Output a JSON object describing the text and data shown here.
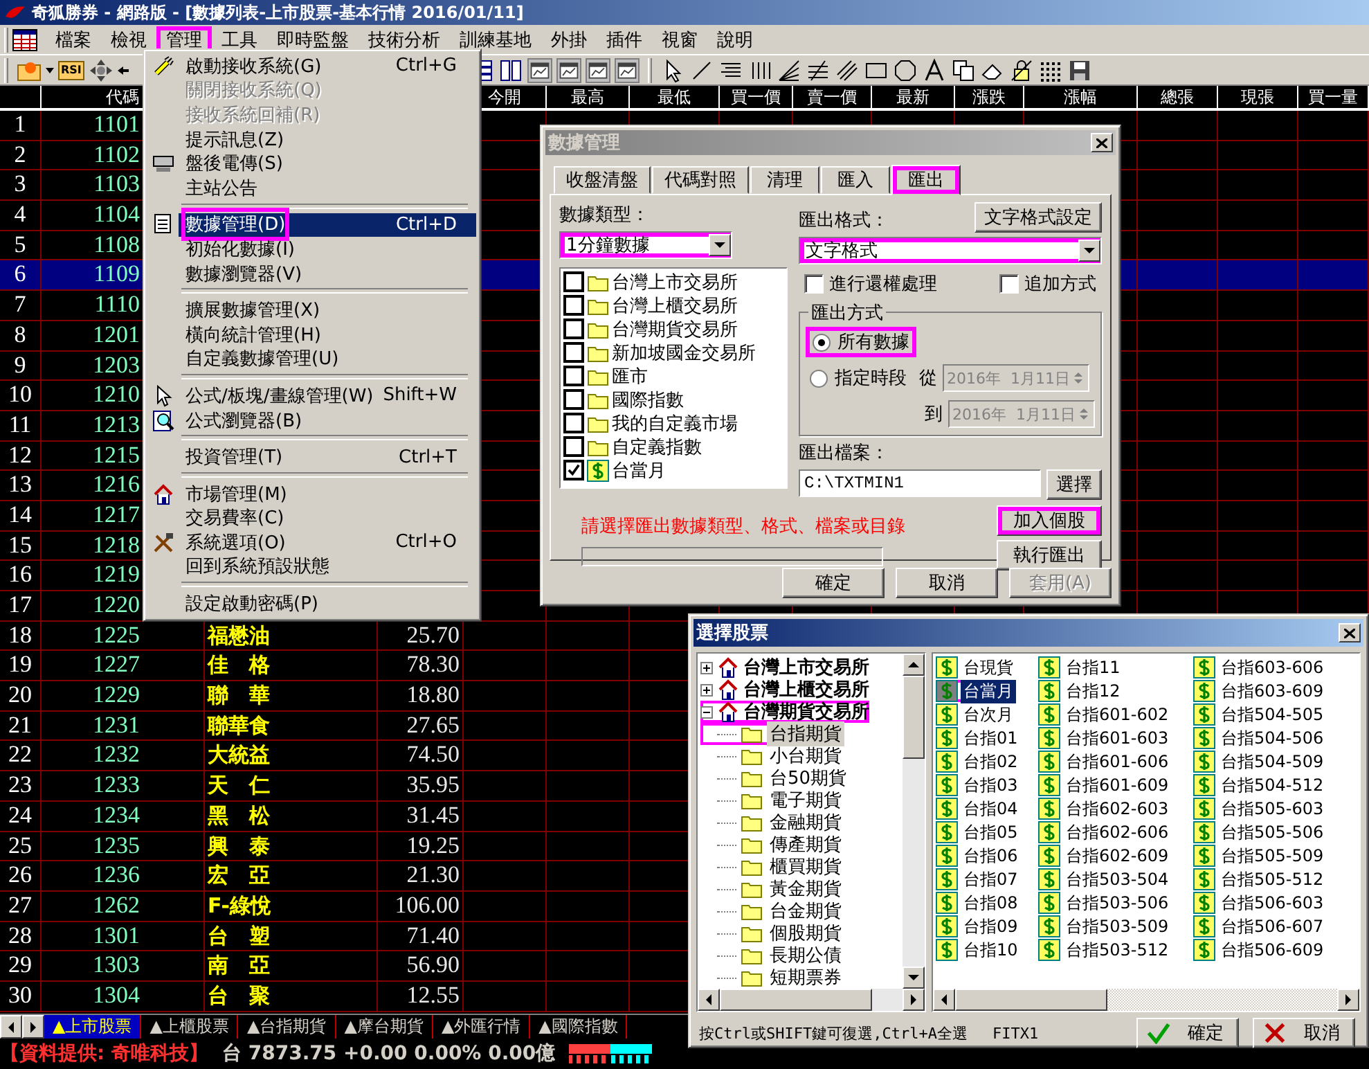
{
  "window": {
    "title": "奇狐勝券 - 網路版 - [數據列表-上市股票-基本行情 2016/01/11]"
  },
  "menu_bar": [
    {
      "label": "檔案",
      "highlighted": false
    },
    {
      "label": "檢視",
      "highlighted": false
    },
    {
      "label": "管理",
      "highlighted": true
    },
    {
      "label": "工具",
      "highlighted": false
    },
    {
      "label": "即時監盤",
      "highlighted": false
    },
    {
      "label": "技術分析",
      "highlighted": false
    },
    {
      "label": "訓練基地",
      "highlighted": false
    },
    {
      "label": "外掛",
      "highlighted": false
    },
    {
      "label": "插件",
      "highlighted": false
    },
    {
      "label": "視窗",
      "highlighted": false
    },
    {
      "label": "說明",
      "highlighted": false
    }
  ],
  "toolbar": {
    "rsi_label": "RSI"
  },
  "table": {
    "columns": [
      {},
      {
        "label": "代碼"
      },
      {},
      {},
      {
        "label": "今開"
      },
      {
        "label": "最高"
      },
      {
        "label": "最低"
      },
      {
        "label": "買一價"
      },
      {
        "label": "賣一價"
      },
      {
        "label": "最新"
      },
      {
        "label": "漲跌"
      },
      {
        "label": "漲幅"
      },
      {
        "label": "總張"
      },
      {
        "label": "現張"
      },
      {
        "label": "買一量"
      }
    ],
    "rows": [
      {
        "number": "1",
        "code": "1101",
        "selected": false
      },
      {
        "number": "2",
        "code": "1102",
        "selected": false
      },
      {
        "number": "3",
        "code": "1103",
        "selected": false
      },
      {
        "number": "4",
        "code": "1104",
        "selected": false
      },
      {
        "number": "5",
        "code": "1108",
        "selected": false
      },
      {
        "number": "6",
        "code": "1109",
        "selected": true
      },
      {
        "number": "7",
        "code": "1110",
        "selected": false
      },
      {
        "number": "8",
        "code": "1201",
        "selected": false
      },
      {
        "number": "9",
        "code": "1203",
        "selected": false
      },
      {
        "number": "10",
        "code": "1210",
        "selected": false
      },
      {
        "number": "11",
        "code": "1213",
        "selected": false
      },
      {
        "number": "12",
        "code": "1215",
        "selected": false
      },
      {
        "number": "13",
        "code": "1216",
        "selected": false
      },
      {
        "number": "14",
        "code": "1217",
        "selected": false
      },
      {
        "number": "15",
        "code": "1218",
        "selected": false
      },
      {
        "number": "16",
        "code": "1219",
        "selected": false
      },
      {
        "number": "17",
        "code": "1220",
        "selected": false
      },
      {
        "number": "18",
        "code": "1225",
        "name": "福懋油",
        "price": "25.70",
        "selected": false
      },
      {
        "number": "19",
        "code": "1227",
        "name": "佳　格",
        "price": "78.30",
        "selected": false
      },
      {
        "number": "20",
        "code": "1229",
        "name": "聯　華",
        "price": "18.80",
        "selected": false
      },
      {
        "number": "21",
        "code": "1231",
        "name": "聯華食",
        "price": "27.65",
        "selected": false
      },
      {
        "number": "22",
        "code": "1232",
        "name": "大統益",
        "price": "74.50",
        "selected": false
      },
      {
        "number": "23",
        "code": "1233",
        "name": "天　仁",
        "price": "35.95",
        "selected": false
      },
      {
        "number": "24",
        "code": "1234",
        "name": "黑　松",
        "price": "31.45",
        "selected": false
      },
      {
        "number": "25",
        "code": "1235",
        "name": "興　泰",
        "price": "19.25",
        "selected": false
      },
      {
        "number": "26",
        "code": "1236",
        "name": "宏　亞",
        "price": "21.30",
        "selected": false
      },
      {
        "number": "27",
        "code": "1262",
        "name": "F-綠悅",
        "price": "106.00",
        "selected": false
      },
      {
        "number": "28",
        "code": "1301",
        "name": "台　塑",
        "price": "71.40",
        "selected": false
      },
      {
        "number": "29",
        "code": "1303",
        "name": "南　亞",
        "price": "56.90",
        "selected": false
      },
      {
        "number": "30",
        "code": "1304",
        "name": "台　聚",
        "price": "12.55",
        "selected": false
      }
    ]
  },
  "menu": {
    "items": [
      {
        "kind": "item",
        "label": "啟動接收系統(G)",
        "shortcut": "Ctrl+G",
        "disabled": false,
        "selected": false,
        "highlighted": false
      },
      {
        "kind": "item",
        "label": "關閉接收系統(Q)",
        "disabled": true,
        "selected": false,
        "highlighted": false
      },
      {
        "kind": "item",
        "label": "接收系統回補(R)",
        "disabled": true,
        "selected": false,
        "highlighted": false
      },
      {
        "kind": "item",
        "label": "提示訊息(Z)",
        "disabled": false,
        "selected": false,
        "highlighted": false
      },
      {
        "kind": "item",
        "label": "盤後電傳(S)",
        "disabled": false,
        "selected": false,
        "highlighted": false
      },
      {
        "kind": "item",
        "label": "主站公告",
        "disabled": false,
        "selected": false,
        "highlighted": false
      },
      {
        "kind": "separator"
      },
      {
        "kind": "item",
        "label": "數據管理(D)",
        "shortcut": "Ctrl+D",
        "disabled": false,
        "selected": true,
        "highlighted": true
      },
      {
        "kind": "item",
        "label": "初始化數據(I)",
        "disabled": false,
        "selected": false,
        "highlighted": false
      },
      {
        "kind": "item",
        "label": "數據瀏覽器(V)",
        "disabled": false,
        "selected": false,
        "highlighted": false
      },
      {
        "kind": "separator"
      },
      {
        "kind": "item",
        "label": "擴展數據管理(X)",
        "disabled": false,
        "selected": false,
        "highlighted": false
      },
      {
        "kind": "item",
        "label": "橫向統計管理(H)",
        "disabled": false,
        "selected": false,
        "highlighted": false
      },
      {
        "kind": "item",
        "label": "自定義數據管理(U)",
        "disabled": false,
        "selected": false,
        "highlighted": false
      },
      {
        "kind": "separator"
      },
      {
        "kind": "item",
        "label": "公式/板塊/畫線管理(W)",
        "shortcut": "Shift+W",
        "disabled": false,
        "selected": false,
        "highlighted": false
      },
      {
        "kind": "item",
        "label": "公式瀏覽器(B)",
        "disabled": false,
        "selected": false,
        "highlighted": false
      },
      {
        "kind": "separator"
      },
      {
        "kind": "item",
        "label": "投資管理(T)",
        "shortcut": "Ctrl+T",
        "disabled": false,
        "selected": false,
        "highlighted": false
      },
      {
        "kind": "separator"
      },
      {
        "kind": "item",
        "label": "市場管理(M)",
        "disabled": false,
        "selected": false,
        "highlighted": false
      },
      {
        "kind": "item",
        "label": "交易費率(C)",
        "disabled": false,
        "selected": false,
        "highlighted": false
      },
      {
        "kind": "item",
        "label": "系統選項(O)",
        "shortcut": "Ctrl+O",
        "disabled": false,
        "selected": false,
        "highlighted": false
      },
      {
        "kind": "item",
        "label": "回到系統預設狀態",
        "disabled": false,
        "selected": false,
        "highlighted": false
      },
      {
        "kind": "separator"
      },
      {
        "kind": "item",
        "label": "設定啟動密碼(P)",
        "disabled": false,
        "selected": false,
        "highlighted": false
      }
    ]
  },
  "data_dialog": {
    "title": "數據管理",
    "active": false,
    "tabs": [
      {
        "label": "收盤清盤",
        "selected": false,
        "highlighted": false
      },
      {
        "label": "代碼對照",
        "selected": false,
        "highlighted": false
      },
      {
        "label": "清理",
        "selected": false,
        "highlighted": false
      },
      {
        "label": "匯入",
        "selected": false,
        "highlighted": false
      },
      {
        "label": "匯出",
        "selected": true,
        "highlighted": true
      }
    ],
    "type_label": "數據類型：",
    "type_select": {
      "value": "1分鐘數據",
      "highlighted": true
    },
    "markets": [
      {
        "kind": "folder",
        "label": "台灣上市交易所",
        "checked": false
      },
      {
        "kind": "folder",
        "label": "台灣上櫃交易所",
        "checked": false
      },
      {
        "kind": "folder",
        "label": "台灣期貨交易所",
        "checked": false
      },
      {
        "kind": "folder",
        "label": "新加坡國金交易所",
        "checked": false
      },
      {
        "kind": "folder",
        "label": "匯市",
        "checked": false
      },
      {
        "kind": "folder",
        "label": "國際指數",
        "checked": false
      },
      {
        "kind": "folder",
        "label": "我的自定義市場",
        "checked": false
      },
      {
        "kind": "folder",
        "label": "自定義指數",
        "checked": false
      },
      {
        "kind": "contract",
        "label": "台當月",
        "checked": true
      }
    ],
    "message": "請選擇匯出數據類型、格式、檔案或目錄",
    "progress": {
      "level": 0
    },
    "format_label": "匯出格式：",
    "format_settings_button": "文字格式設定",
    "format_select": {
      "value": "文字格式",
      "highlighted": true
    },
    "options": [
      {
        "label": "進行還權處理",
        "checked": false
      },
      {
        "label": "追加方式",
        "checked": false
      }
    ],
    "mode_group": {
      "title": "匯出方式",
      "options": [
        {
          "label": "所有數據",
          "selected": true,
          "highlighted": true
        },
        {
          "label": "指定時段",
          "selected": false,
          "highlighted": false
        }
      ],
      "from_label": "從",
      "from_date": "2016年  1月11日",
      "to_label": "到",
      "to_date": "2016年  1月11日",
      "dates_disabled": true
    },
    "file_label": "匯出檔案：",
    "file_path": "C:\\TXTMIN1",
    "browse_button": "選擇",
    "actions": [
      {
        "label": "加入個股",
        "highlighted": true
      },
      {
        "label": "執行匯出",
        "highlighted": false
      }
    ],
    "buttons": [
      {
        "label": "確定",
        "disabled": false
      },
      {
        "label": "取消",
        "disabled": false
      },
      {
        "label": "套用(A)",
        "disabled": true
      }
    ]
  },
  "stock_dialog": {
    "title": "選擇股票",
    "active": true,
    "tree": [
      {
        "label": "台灣上市交易所",
        "expanded": false,
        "highlighted": false
      },
      {
        "label": "台灣上櫃交易所",
        "expanded": false,
        "highlighted": false
      },
      {
        "label": "台灣期貨交易所",
        "expanded": true,
        "highlighted": true,
        "children": [
          {
            "label": "台指期貨",
            "selected": true,
            "highlighted": true
          },
          {
            "label": "小台期貨",
            "selected": false,
            "highlighted": false
          },
          {
            "label": "台50期貨",
            "selected": false,
            "highlighted": false
          },
          {
            "label": "電子期貨",
            "selected": false,
            "highlighted": false
          },
          {
            "label": "金融期貨",
            "selected": false,
            "highlighted": false
          },
          {
            "label": "傳產期貨",
            "selected": false,
            "highlighted": false
          },
          {
            "label": "櫃買期貨",
            "selected": false,
            "highlighted": false
          },
          {
            "label": "黃金期貨",
            "selected": false,
            "highlighted": false
          },
          {
            "label": "台金期貨",
            "selected": false,
            "highlighted": false
          },
          {
            "label": "個股期貨",
            "selected": false,
            "highlighted": false
          },
          {
            "label": "長期公債",
            "selected": false,
            "highlighted": false
          },
          {
            "label": "短期票券",
            "selected": false,
            "highlighted": false
          }
        ]
      }
    ],
    "list": [
      {
        "label": "台現貨",
        "selected": false,
        "highlighted": false
      },
      {
        "label": "台當月",
        "selected": true,
        "highlighted": true
      },
      {
        "label": "台次月",
        "selected": false,
        "highlighted": false
      },
      {
        "label": "台指01",
        "selected": false,
        "highlighted": false
      },
      {
        "label": "台指02",
        "selected": false,
        "highlighted": false
      },
      {
        "label": "台指03",
        "selected": false,
        "highlighted": false
      },
      {
        "label": "台指04",
        "selected": false,
        "highlighted": false
      },
      {
        "label": "台指05",
        "selected": false,
        "highlighted": false
      },
      {
        "label": "台指06",
        "selected": false,
        "highlighted": false
      },
      {
        "label": "台指07",
        "selected": false,
        "highlighted": false
      },
      {
        "label": "台指08",
        "selected": false,
        "highlighted": false
      },
      {
        "label": "台指09",
        "selected": false,
        "highlighted": false
      },
      {
        "label": "台指10",
        "selected": false,
        "highlighted": false
      },
      {
        "label": "台指11",
        "selected": false,
        "highlighted": false
      },
      {
        "label": "台指12",
        "selected": false,
        "highlighted": false
      },
      {
        "label": "台指601-602",
        "selected": false,
        "highlighted": false
      },
      {
        "label": "台指601-603",
        "selected": false,
        "highlighted": false
      },
      {
        "label": "台指601-606",
        "selected": false,
        "highlighted": false
      },
      {
        "label": "台指601-609",
        "selected": false,
        "highlighted": false
      },
      {
        "label": "台指602-603",
        "selected": false,
        "highlighted": false
      },
      {
        "label": "台指602-606",
        "selected": false,
        "highlighted": false
      },
      {
        "label": "台指602-609",
        "selected": false,
        "highlighted": false
      },
      {
        "label": "台指503-504",
        "selected": false,
        "highlighted": false
      },
      {
        "label": "台指503-506",
        "selected": false,
        "highlighted": false
      },
      {
        "label": "台指503-509",
        "selected": false,
        "highlighted": false
      },
      {
        "label": "台指503-512",
        "selected": false,
        "highlighted": false
      },
      {
        "label": "台指603-606",
        "selected": false,
        "highlighted": false
      },
      {
        "label": "台指603-609",
        "selected": false,
        "highlighted": false
      },
      {
        "label": "台指504-505",
        "selected": false,
        "highlighted": false
      },
      {
        "label": "台指504-506",
        "selected": false,
        "highlighted": false
      },
      {
        "label": "台指504-509",
        "selected": false,
        "highlighted": false
      },
      {
        "label": "台指504-512",
        "selected": false,
        "highlighted": false
      },
      {
        "label": "台指505-603",
        "selected": false,
        "highlighted": false
      },
      {
        "label": "台指505-506",
        "selected": false,
        "highlighted": false
      },
      {
        "label": "台指505-509",
        "selected": false,
        "highlighted": false
      },
      {
        "label": "台指505-512",
        "selected": false,
        "highlighted": false
      },
      {
        "label": "台指506-603",
        "selected": false,
        "highlighted": false
      },
      {
        "label": "台指506-607",
        "selected": false,
        "highlighted": false
      },
      {
        "label": "台指506-609",
        "selected": false,
        "highlighted": false
      }
    ],
    "hint": "按Ctrl或SHIFT鍵可復選,Ctrl+A全選",
    "code": "FITX1",
    "buttons": [
      {
        "kind": "ok",
        "label": "確定"
      },
      {
        "kind": "cancel",
        "label": "取消"
      }
    ]
  },
  "sheet_tabs": [
    {
      "label": "▲上市股票",
      "selected": true
    },
    {
      "label": "▲上櫃股票",
      "selected": false
    },
    {
      "label": "▲台指期貨",
      "selected": false
    },
    {
      "label": "▲摩台期貨",
      "selected": false
    },
    {
      "label": "▲外匯行情",
      "selected": false
    },
    {
      "label": "▲國際指數",
      "selected": false
    }
  ],
  "status_bar": {
    "source": "【資料提供: 奇唯科技】",
    "quote": "台 7873.75 +0.00 0.00% 0.00億"
  }
}
